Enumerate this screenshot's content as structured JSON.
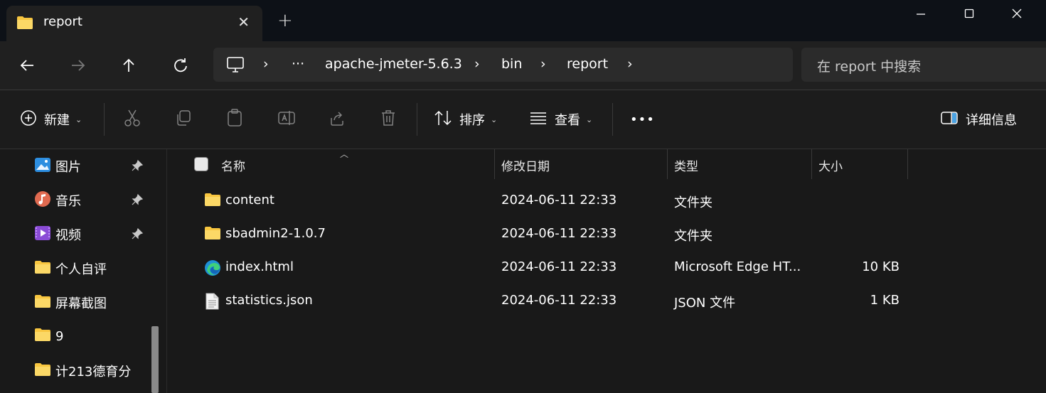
{
  "window": {
    "tab_title": "report",
    "tab_close": "✕",
    "new_tab": "+"
  },
  "nav": {
    "address_segments": [
      "›",
      "···",
      "apache-jmeter-5.6.3",
      "›",
      "bin",
      "›",
      "report",
      "›"
    ],
    "search_placeholder": "在 report 中搜索"
  },
  "toolbar": {
    "new_label": "新建",
    "sort_label": "排序",
    "view_label": "查看",
    "more_label": "•••",
    "details_label": "详细信息"
  },
  "sidebar": {
    "items": [
      {
        "label": "图片",
        "icon": "pictures-icon",
        "pinned": true
      },
      {
        "label": "音乐",
        "icon": "music-icon",
        "pinned": true
      },
      {
        "label": "视频",
        "icon": "videos-icon",
        "pinned": true
      },
      {
        "label": "个人自评",
        "icon": "folder-icon",
        "pinned": false
      },
      {
        "label": "屏幕截图",
        "icon": "folder-icon",
        "pinned": false
      },
      {
        "label": "9",
        "icon": "folder-icon",
        "pinned": false
      },
      {
        "label": "计213德育分",
        "icon": "folder-icon",
        "pinned": false
      }
    ]
  },
  "columns": {
    "name": "名称",
    "date": "修改日期",
    "type": "类型",
    "size": "大小"
  },
  "files": [
    {
      "name": "content",
      "date": "2024-06-11 22:33",
      "type": "文件夹",
      "size": "",
      "icon": "folder-icon"
    },
    {
      "name": "sbadmin2-1.0.7",
      "date": "2024-06-11 22:33",
      "type": "文件夹",
      "size": "",
      "icon": "folder-icon"
    },
    {
      "name": "index.html",
      "date": "2024-06-11 22:33",
      "type": "Microsoft Edge HT...",
      "size": "10 KB",
      "icon": "edge-icon"
    },
    {
      "name": "statistics.json",
      "date": "2024-06-11 22:33",
      "type": "JSON 文件",
      "size": "1 KB",
      "icon": "file-icon"
    }
  ],
  "colors": {
    "folder": "#f8c640",
    "background": "#191919",
    "titlebar": "#0d1117"
  }
}
